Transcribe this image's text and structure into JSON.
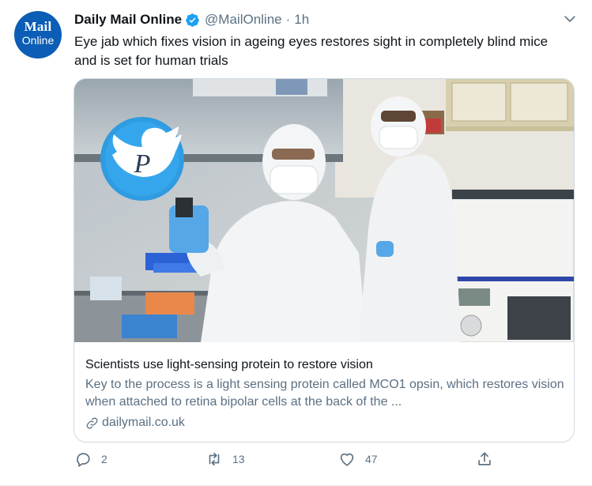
{
  "account": {
    "avatar_line1": "Mail",
    "avatar_line2": "Online",
    "display_name": "Daily Mail Online",
    "handle": "@MailOnline",
    "separator": "·",
    "timestamp": "1h"
  },
  "tweet": {
    "text": "Eye jab which fixes vision in ageing eyes restores sight in completely blind mice and is set for human trials"
  },
  "card": {
    "title": "Scientists use light-sensing protein to restore vision",
    "description": "Key to the process is a light sensing protein called MCO1 opsin, which restores vision when attached to retina bipolar cells at the back of the ...",
    "domain": "dailymail.co.uk"
  },
  "actions": {
    "replies": "2",
    "retweets": "13",
    "likes": "47"
  },
  "colors": {
    "brand_blue": "#0b5db5",
    "verified_blue": "#1da1f2",
    "secondary_text": "#5b7083",
    "retweet_green": "#17bf63"
  },
  "icons": [
    "verified-icon",
    "chevron-down-icon",
    "link-icon",
    "reply-icon",
    "retweet-icon",
    "like-icon",
    "share-icon",
    "twitter-bird-icon"
  ]
}
